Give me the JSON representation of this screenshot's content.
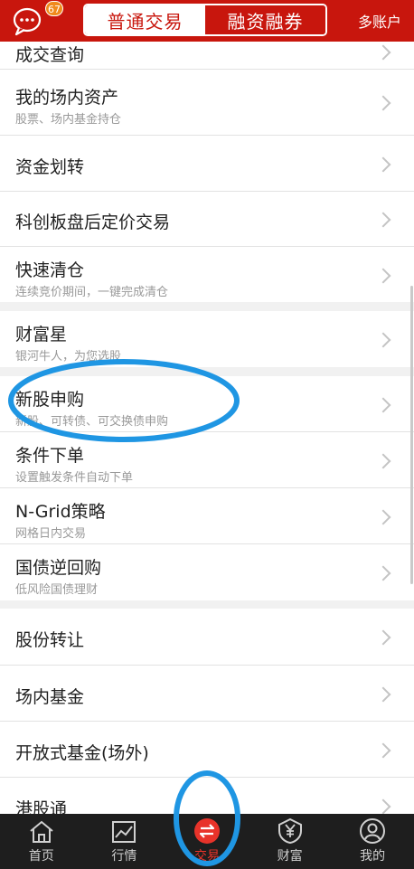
{
  "header": {
    "message_badge": "67",
    "tab_normal": "普通交易",
    "tab_margin": "融资融券",
    "multi_account": "多账户"
  },
  "menu": {
    "trade_query": {
      "title": "成交查询"
    },
    "assets": {
      "title": "我的场内资产",
      "subtitle": "股票、场内基金持仓"
    },
    "fund_transfer": {
      "title": "资金划转"
    },
    "star_after_hours": {
      "title": "科创板盘后定价交易"
    },
    "quick_clear": {
      "title": "快速清仓",
      "subtitle": "连续竞价期间，一键完成清仓"
    },
    "wealth_star": {
      "title": "财富星",
      "subtitle": "银河牛人，为您选股"
    },
    "ipo_subscribe": {
      "title": "新股申购",
      "subtitle": "新股、可转债、可交换债申购"
    },
    "conditional_order": {
      "title": "条件下单",
      "subtitle": "设置触发条件自动下单"
    },
    "ngrid": {
      "title": "N-Grid策略",
      "subtitle": "网格日内交易"
    },
    "reverse_repo": {
      "title": "国债逆回购",
      "subtitle": "低风险国债理财"
    },
    "share_transfer": {
      "title": "股份转让"
    },
    "exchange_fund": {
      "title": "场内基金"
    },
    "open_fund": {
      "title": "开放式基金(场外)"
    },
    "hk_connect": {
      "title": "港股通"
    }
  },
  "tabbar": {
    "home": "首页",
    "market": "行情",
    "trade": "交易",
    "wealth": "财富",
    "mine": "我的"
  },
  "colors": {
    "brand_red": "#c8160d",
    "annotation_blue": "#1f96e3",
    "tabbar_bg": "#1e1e1e"
  }
}
